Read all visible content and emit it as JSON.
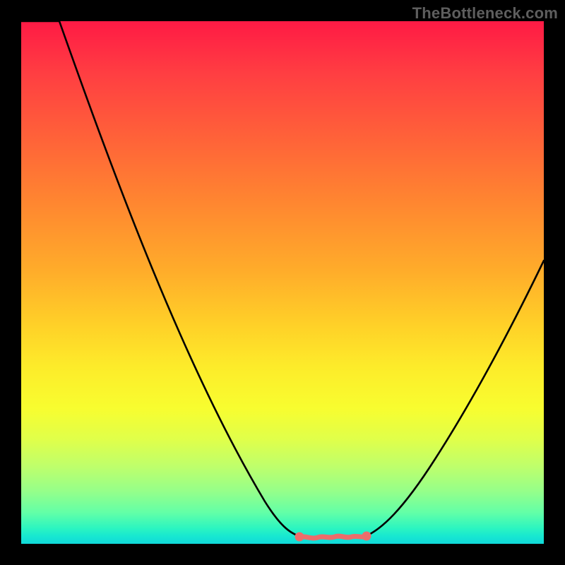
{
  "watermark": "TheBottleneck.com",
  "chart_data": {
    "type": "line",
    "title": "",
    "xlabel": "",
    "ylabel": "",
    "xlim": [
      0,
      100
    ],
    "ylim": [
      0,
      100
    ],
    "grid": false,
    "legend": false,
    "background": "rainbow_vertical_gradient",
    "series": [
      {
        "name": "bottleneck_curve_left",
        "color": "#000000",
        "x": [
          0,
          7,
          15,
          25,
          35,
          45,
          53
        ],
        "y": [
          100,
          100,
          70,
          40,
          18,
          4,
          1
        ]
      },
      {
        "name": "bottleneck_curve_right",
        "color": "#000000",
        "x": [
          66,
          72,
          80,
          88,
          95,
          100
        ],
        "y": [
          1,
          4,
          15,
          30,
          45,
          54
        ]
      },
      {
        "name": "optimal_range_marker",
        "color": "#ec6d6b",
        "x": [
          53,
          56,
          59,
          62,
          66
        ],
        "y": [
          1.1,
          0.9,
          1.1,
          0.9,
          1.1
        ]
      }
    ],
    "annotations": [
      {
        "text": "TheBottleneck.com",
        "position": "top-right",
        "role": "watermark"
      }
    ]
  }
}
